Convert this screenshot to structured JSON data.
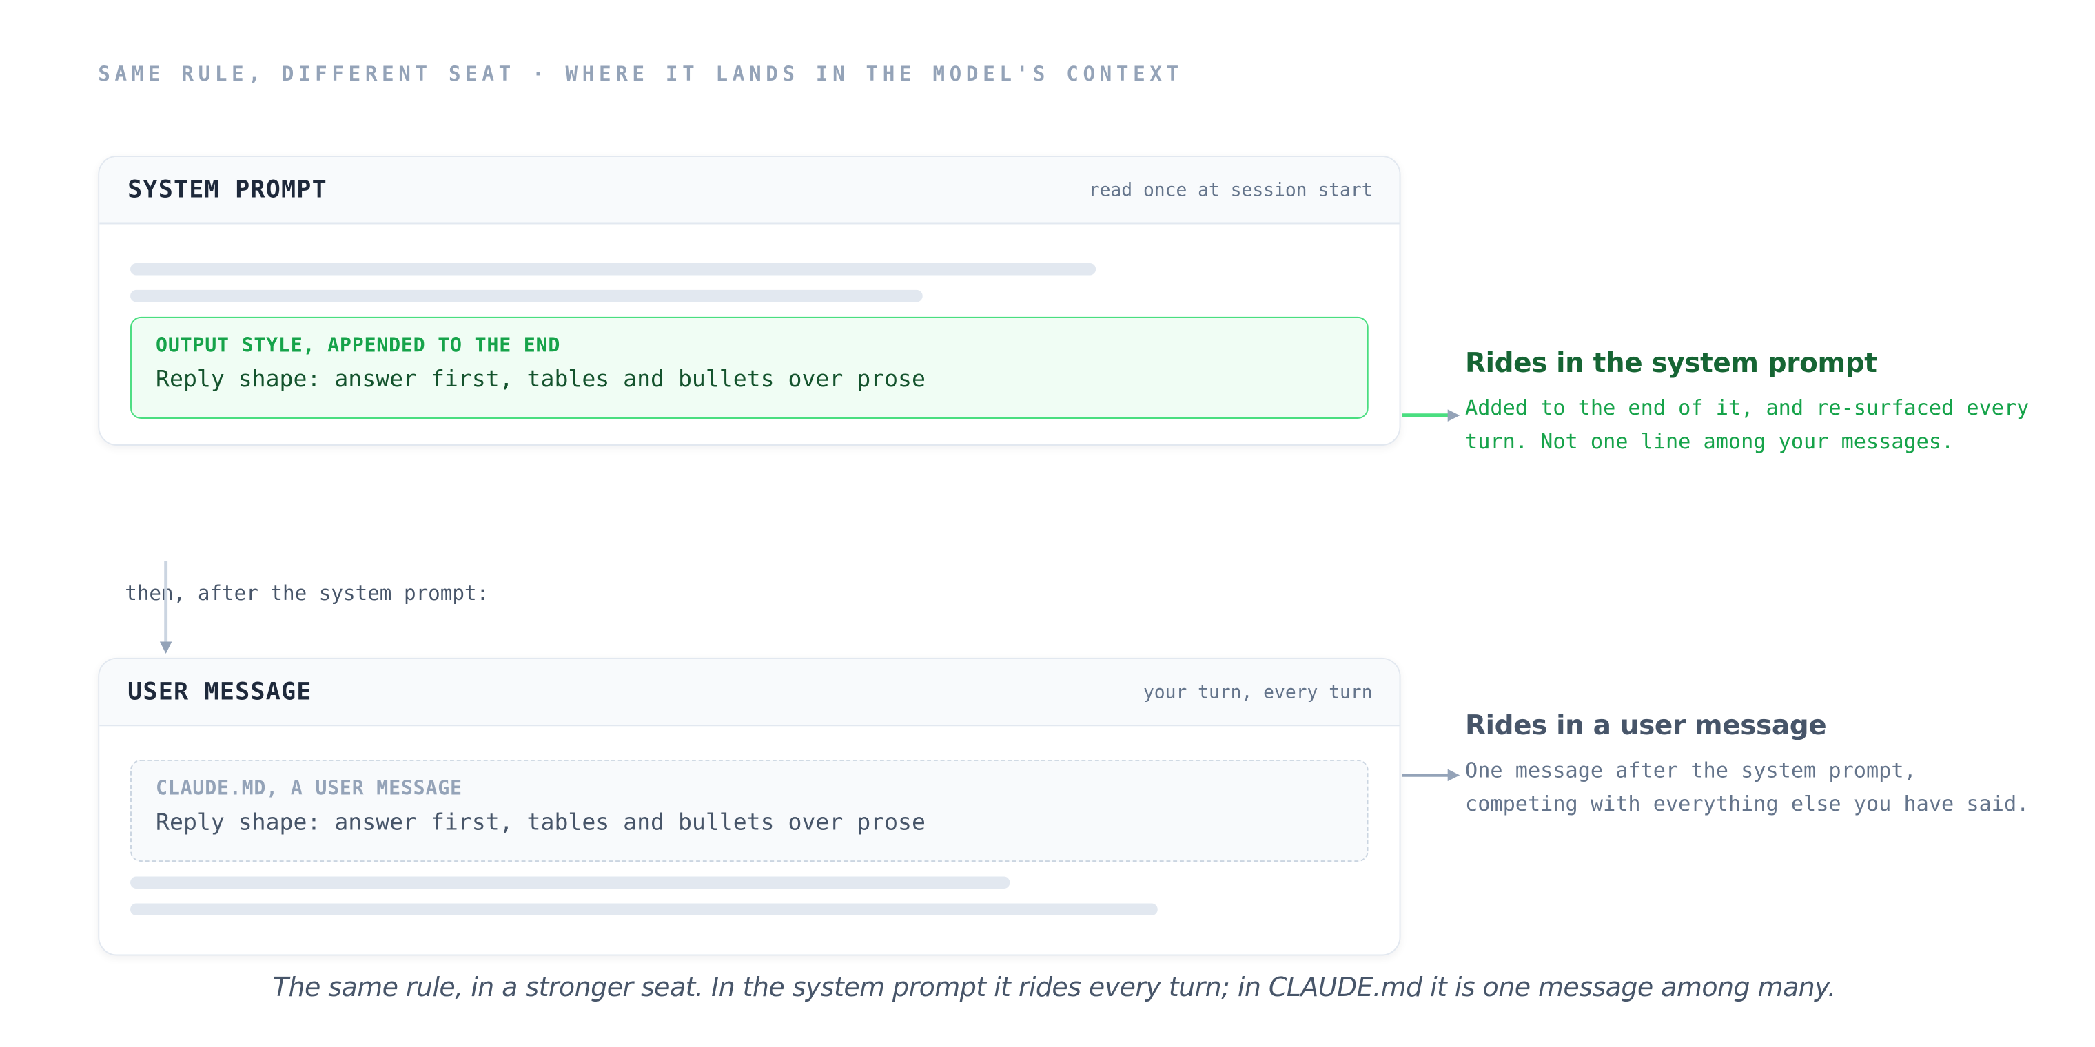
{
  "header": {
    "eyebrow": "SAME RULE, DIFFERENT SEAT · WHERE IT LANDS IN THE MODEL'S CONTEXT"
  },
  "system_card": {
    "title": "SYSTEM PROMPT",
    "note": "read once at session start",
    "rule_label": "OUTPUT STYLE, APPENDED TO THE END",
    "rule_text": "Reply shape: answer first, tables and bullets over prose"
  },
  "connector": {
    "label": "then, after the system prompt:"
  },
  "user_card": {
    "title": "USER MESSAGE",
    "note": "your turn, every turn",
    "rule_label": "CLAUDE.MD, A USER MESSAGE",
    "rule_text": "Reply shape: answer first, tables and bullets over prose"
  },
  "annotations": {
    "system": {
      "title": "Rides in the system prompt",
      "text": "Added to the end of it, and re-surfaced every turn. Not one line among your messages."
    },
    "user": {
      "title": "Rides in a user message",
      "text": "One message after the system prompt, competing with everything else you have said."
    }
  },
  "caption": "The same rule, in a stronger seat. In the system prompt it rides every turn; in CLAUDE.md it is one message among many.",
  "colors": {
    "accent_green": "#16a34a",
    "accent_green_dark": "#166534",
    "muted_gray": "#64748b",
    "arrow_green": "#4ade80",
    "arrow_gray": "#94a3b8"
  }
}
